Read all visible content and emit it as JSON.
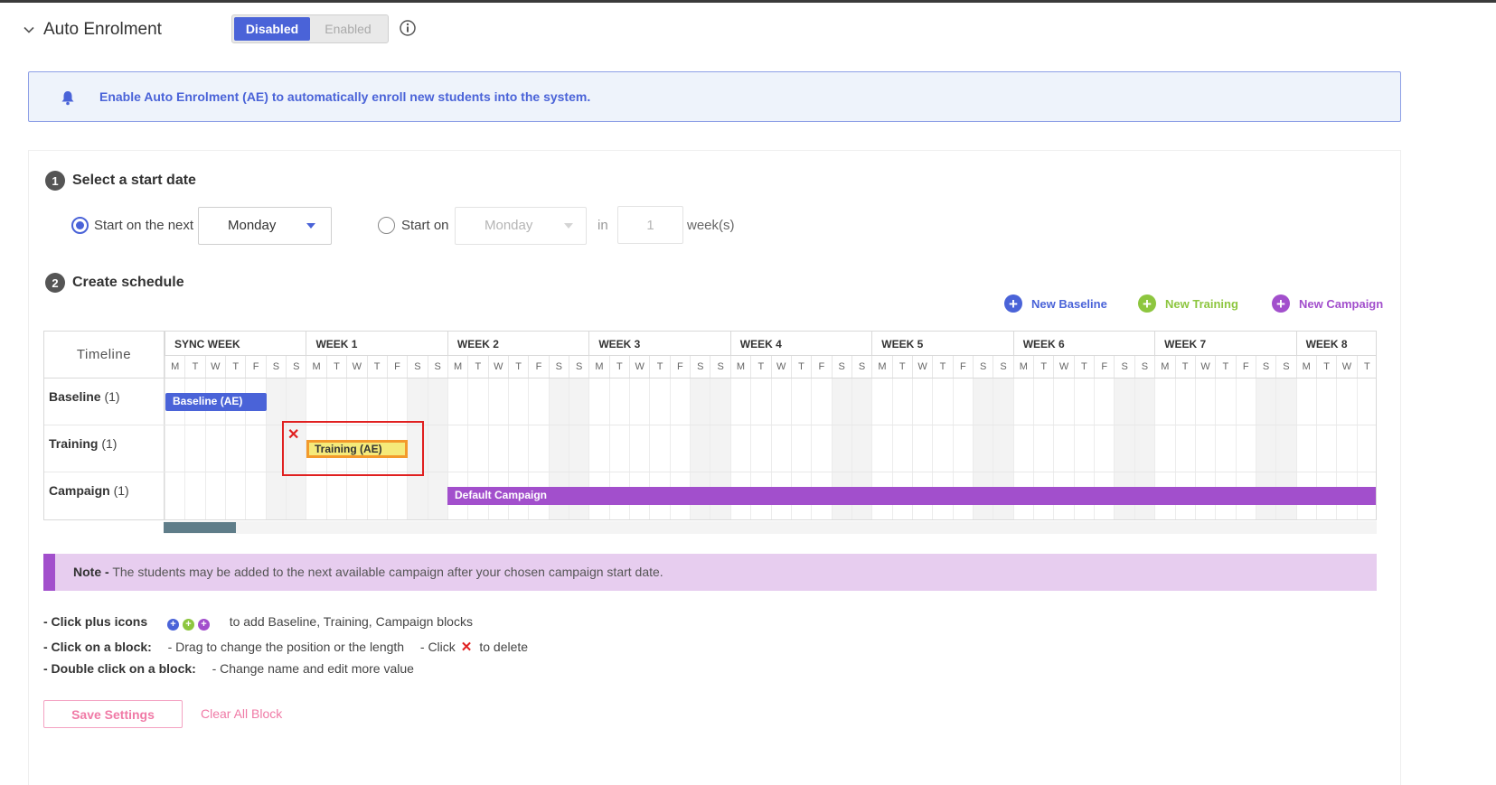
{
  "header": {
    "title": "Auto Enrolment",
    "toggle": {
      "disabled_label": "Disabled",
      "enabled_label": "Enabled",
      "selected": "Disabled"
    }
  },
  "banner": {
    "text": "Enable Auto Enrolment (AE) to automatically enroll new students into the system."
  },
  "step1": {
    "number": "1",
    "title": "Select a start date",
    "option_next_label": "Start on the next",
    "option_next_value": "Monday",
    "option_on_label": "Start on",
    "option_on_value": "Monday",
    "in_label": "in",
    "weeks_value": "1",
    "weeks_label": "week(s)"
  },
  "step2": {
    "number": "2",
    "title": "Create schedule",
    "new_baseline": "New Baseline",
    "new_training": "New Training",
    "new_campaign": "New Campaign"
  },
  "schedule": {
    "timeline_label": "Timeline",
    "weeks": [
      "SYNC WEEK",
      "WEEK 1",
      "WEEK 2",
      "WEEK 3",
      "WEEK 4",
      "WEEK 5",
      "WEEK 6",
      "WEEK 7",
      "WEEK 8"
    ],
    "day_letters": [
      "M",
      "T",
      "W",
      "T",
      "F",
      "S",
      "S"
    ],
    "rows": [
      {
        "name": "Baseline",
        "count": "(1)"
      },
      {
        "name": "Training",
        "count": "(1)"
      },
      {
        "name": "Campaign",
        "count": "(1)"
      }
    ],
    "blocks": [
      {
        "row": 0,
        "label": "Baseline (AE)",
        "type": "baseline"
      },
      {
        "row": 1,
        "label": "Training (AE)",
        "type": "training",
        "selected": true
      },
      {
        "row": 2,
        "label": "Default Campaign",
        "type": "campaign"
      }
    ]
  },
  "note": {
    "label": "Note -",
    "text": "The students may be added to the next available campaign after your chosen campaign start date."
  },
  "help": {
    "line1_label": "- Click plus icons",
    "line1_text": "to add Baseline, Training, Campaign blocks",
    "line2_label": "- Click on a block:",
    "line2_text1": "- Drag to change the position or the length",
    "line2_text2": "- Click",
    "line2_text3": "to delete",
    "line3_label": "- Double click on a block:",
    "line3_text": "- Change name and edit more value"
  },
  "actions": {
    "save": "Save Settings",
    "clear": "Clear All Block"
  },
  "colors": {
    "primary": "#4a63d8",
    "training": "#8dc63f",
    "campaign": "#a24fcc",
    "danger": "#e02020",
    "pink": "#f07aa6"
  }
}
